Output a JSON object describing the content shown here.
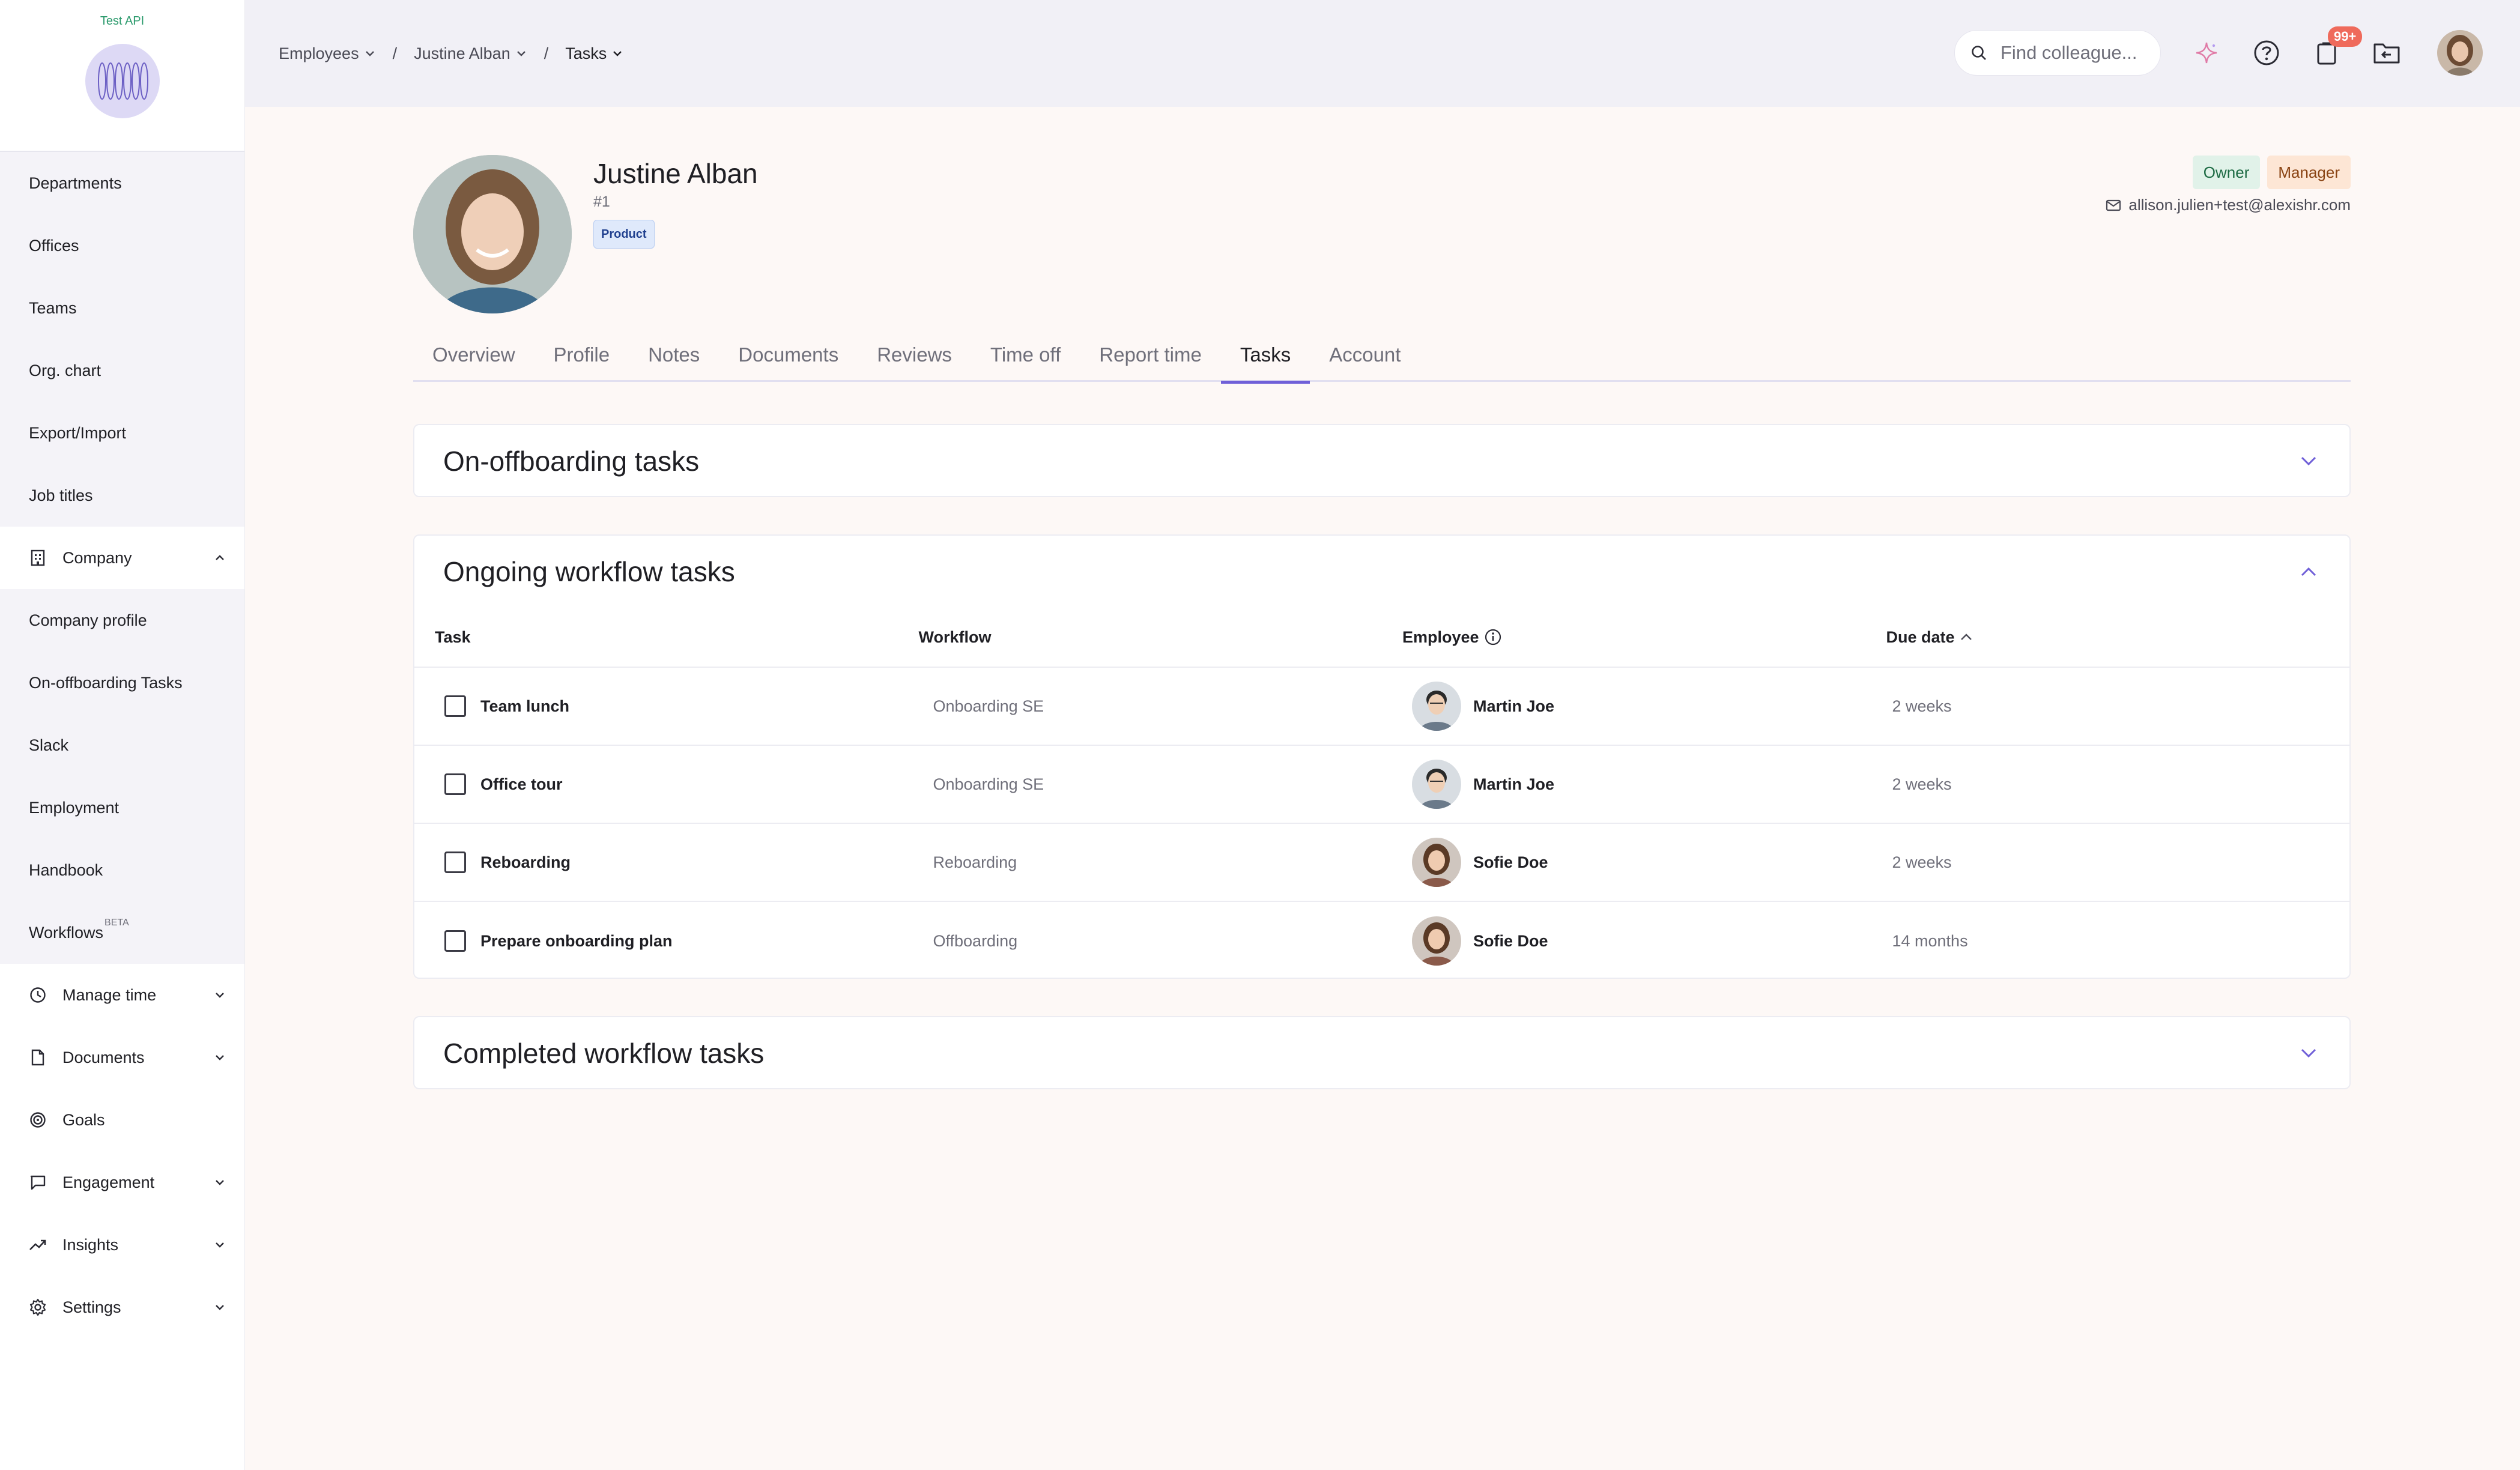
{
  "sidebar": {
    "org_label": "Test API",
    "company_items": [
      {
        "label": "Departments",
        "name": "sidebar-item-departments"
      },
      {
        "label": "Offices",
        "name": "sidebar-item-offices"
      },
      {
        "label": "Teams",
        "name": "sidebar-item-teams"
      },
      {
        "label": "Org. chart",
        "name": "sidebar-item-org-chart"
      },
      {
        "label": "Export/Import",
        "name": "sidebar-item-export-import"
      },
      {
        "label": "Job titles",
        "name": "sidebar-item-job-titles"
      }
    ],
    "company_section": "Company",
    "company_sub_items": [
      {
        "label": "Company profile"
      },
      {
        "label": "On-offboarding Tasks"
      },
      {
        "label": "Slack"
      },
      {
        "label": "Employment"
      },
      {
        "label": "Handbook"
      },
      {
        "label": "Workflows",
        "badge": "BETA"
      }
    ],
    "sections": [
      {
        "label": "Manage time",
        "icon": "clock-icon"
      },
      {
        "label": "Documents",
        "icon": "document-icon"
      },
      {
        "label": "Goals",
        "icon": "target-icon"
      },
      {
        "label": "Engagement",
        "icon": "chat-icon"
      },
      {
        "label": "Insights",
        "icon": "trend-icon"
      },
      {
        "label": "Settings",
        "icon": "gear-icon"
      }
    ]
  },
  "topbar": {
    "breadcrumbs": [
      "Employees",
      "Justine Alban",
      "Tasks"
    ],
    "separator": "/",
    "search_placeholder": "Find colleague...",
    "notification_badge": "99+"
  },
  "profile": {
    "name": "Justine Alban",
    "id": "#1",
    "department_tag": "Product",
    "roles": [
      "Owner",
      "Manager"
    ],
    "email": "allison.julien+test@alexishr.com"
  },
  "tabs": [
    "Overview",
    "Profile",
    "Notes",
    "Documents",
    "Reviews",
    "Time off",
    "Report time",
    "Tasks",
    "Account"
  ],
  "active_tab": "Tasks",
  "panels": {
    "onoffboarding_title": "On-offboarding tasks",
    "ongoing_title": "Ongoing workflow tasks",
    "completed_title": "Completed workflow tasks"
  },
  "table": {
    "headers": {
      "task": "Task",
      "workflow": "Workflow",
      "employee": "Employee",
      "due": "Due date"
    },
    "rows": [
      {
        "task": "Team lunch",
        "workflow": "Onboarding SE",
        "employee": "Martin Joe",
        "due": "2 weeks"
      },
      {
        "task": "Office tour",
        "workflow": "Onboarding SE",
        "employee": "Martin Joe",
        "due": "2 weeks"
      },
      {
        "task": "Reboarding",
        "workflow": "Reboarding",
        "employee": "Sofie Doe",
        "due": "2 weeks"
      },
      {
        "task": "Prepare onboarding plan",
        "workflow": "Offboarding",
        "employee": "Sofie Doe",
        "due": "14 months"
      }
    ]
  },
  "colors": {
    "accent": "#7060d8",
    "brand_green": "#2b9a6c",
    "badge": "#ef6a5b"
  }
}
